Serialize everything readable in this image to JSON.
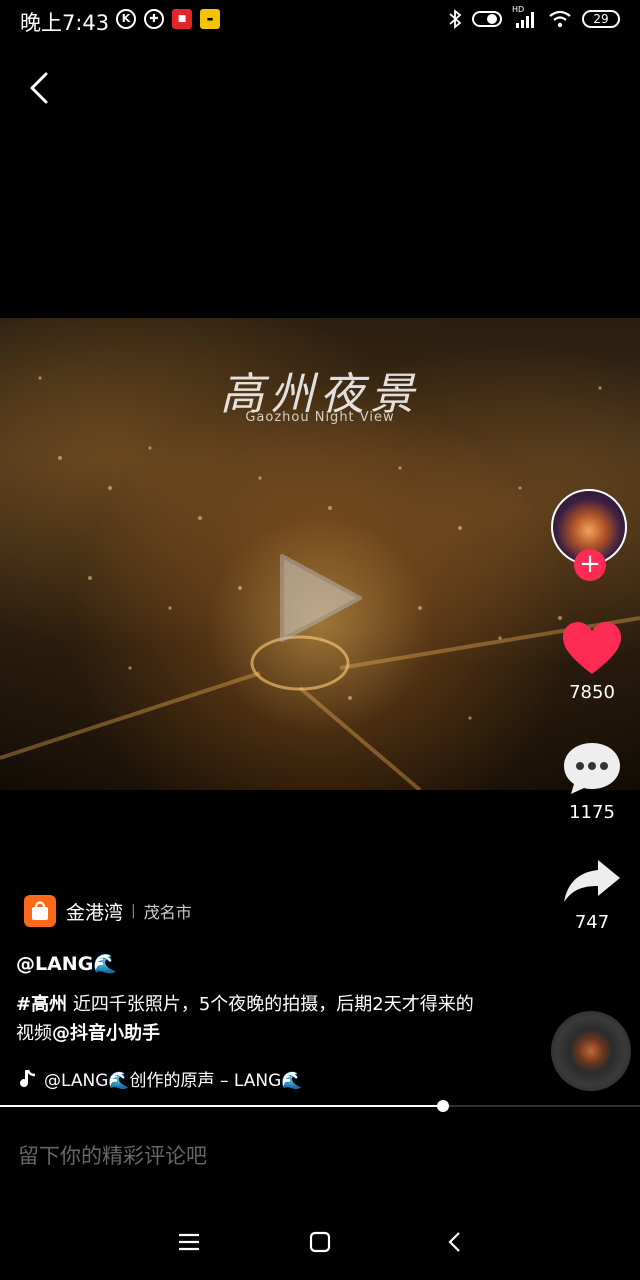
{
  "status_bar": {
    "time": "晚上7:43",
    "icons_left": [
      "k-icon",
      "plus-circle-icon",
      "app-icon",
      "shop-icon"
    ],
    "hd_label": "HD",
    "battery": "29"
  },
  "video": {
    "title": "高州夜景",
    "subtitle": "Gaozhou Night View"
  },
  "actions": {
    "likes": "7850",
    "comments": "1175",
    "shares": "747"
  },
  "location": {
    "name": "金港湾",
    "city": "茂名市"
  },
  "post": {
    "author": "@LANG🌊",
    "hashtag": "#高州",
    "caption_text": " 近四千张照片，5个夜晚的拍摄，后期2天才得来的视频",
    "mention": "@抖音小助手"
  },
  "music": {
    "label": "@LANG🌊创作的原声 – LANG🌊"
  },
  "progress": {
    "fraction": 0.692
  },
  "comment_box": {
    "placeholder": "留下你的精彩评论吧"
  },
  "colors": {
    "like": "#fe2c55",
    "follow": "#fe2c55",
    "shop": "#ff6a1a"
  }
}
